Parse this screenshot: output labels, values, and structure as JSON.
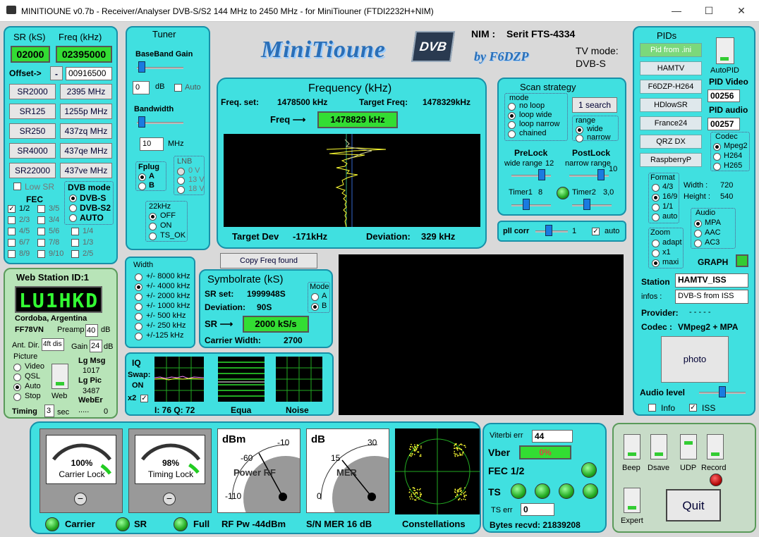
{
  "window": {
    "title": "MINITIOUNE v0.7b - Receiver/Analyser DVB-S/S2 144 MHz to 2450 MHz - for MiniTiouner (FTDI2232H+NIM)",
    "min": "—",
    "max": "☐",
    "close": "✕"
  },
  "sr_panel": {
    "sr_header": "SR (kS)",
    "freq_header": "Freq (kHz)",
    "sr_value": "02000",
    "freq_value": "02395000",
    "offset_label": "Offset->",
    "offset_sign": "-",
    "offset_value": "00916500",
    "sr_buttons": [
      "SR2000",
      "SR125",
      "SR250",
      "SR4000",
      "SR22000"
    ],
    "freq_buttons": [
      "2395 MHz",
      "1255p MHz",
      "437zq MHz",
      "437qe MHz",
      "437ve MHz"
    ],
    "low_sr": "Low SR",
    "fec_label": "FEC",
    "fec_items": [
      "1/2",
      "3/5",
      "2/3",
      "3/4",
      "4/5",
      "5/6",
      "6/7",
      "7/8",
      "8/9",
      "9/10"
    ],
    "dvb_mode_label": "DVB mode",
    "dvb_modes": [
      "DVB-S",
      "DVB-S2",
      "AUTO"
    ],
    "extra_fec": [
      "1/4",
      "1/3",
      "2/5"
    ]
  },
  "tuner": {
    "title": "Tuner",
    "bb_gain": "BaseBand Gain",
    "gain_value": "0",
    "db": "dB",
    "auto": "Auto",
    "bandwidth": "Bandwidth",
    "bw_value": "10",
    "mhz": "MHz",
    "fplug": "Fplug",
    "fplug_a": "A",
    "fplug_b": "B",
    "lnb": "LNB",
    "lnb_opts": [
      "0 V",
      "13 V",
      "18 V"
    ],
    "khz22": "22kHz",
    "khz22_opts": [
      "OFF",
      "ON",
      "TS_OK"
    ]
  },
  "header": {
    "logo": "MiniTioune",
    "logo_dvb": "DVB",
    "logo_by": "by F6DZP",
    "nim_label": "NIM :",
    "nim_value": "Serit FTS-4334",
    "tv_mode_label": "TV mode:",
    "tv_mode_value": "DVB-S"
  },
  "frequency": {
    "title": "Frequency (kHz)",
    "freq_set_label": "Freq. set:",
    "freq_set": "1478500 kHz",
    "target_label": "Target Freq:",
    "target": "1478329kHz",
    "freq_label": "Freq ⟶",
    "freq_value": "1478829 kHz",
    "target_dev_label": "Target Dev",
    "target_dev": "-171kHz",
    "deviation_label": "Deviation:",
    "deviation": "329 kHz"
  },
  "copy_freq": "Copy Freq found",
  "scan": {
    "title": "Scan strategy",
    "mode": "mode",
    "modes": [
      "no loop",
      "loop wide",
      "loop narrow",
      "chained"
    ],
    "search": "1 search",
    "range": "range",
    "ranges": [
      "wide",
      "narrow"
    ],
    "prelock": "PreLock",
    "prelock_sub": "wide range",
    "prelock_val": "12",
    "postlock": "PostLock",
    "postlock_sub": "narrow range",
    "postlock_val": "10",
    "timer1": "Timer1",
    "timer1_val": "8",
    "timer2": "Timer2",
    "timer2_val": "3,0",
    "pll": "pll corr",
    "pll_val": "1",
    "auto": "auto"
  },
  "width": {
    "title": "Width",
    "opts": [
      "+/- 8000 kHz",
      "+/- 4000 kHz",
      "+/- 2000 kHz",
      "+/- 1000 kHz",
      "+/- 500 kHz",
      "+/- 250 kHz",
      "+/-125 kHz"
    ]
  },
  "symbolrate": {
    "title": "Symbolrate (kS)",
    "sr_set_label": "SR set:",
    "sr_set": "1999948S",
    "dev_label": "Deviation:",
    "dev": "90S",
    "sr_label": "SR ⟶",
    "sr_value": "2000 kS/s",
    "carrier_label": "Carrier Width:",
    "carrier": "2700",
    "mode": "Mode",
    "mode_a": "A",
    "mode_b": "B"
  },
  "iq": {
    "title": "IQ",
    "swap": "Swap:",
    "swap_val": "ON",
    "x2": "x2",
    "iq_vals": "I: 76 Q: 72",
    "equa": "Equa",
    "noise": "Noise"
  },
  "web": {
    "title": "Web Station ID:1",
    "callsign": "LU1HKD",
    "city": "Cordoba, Argentina",
    "locator": "FF78VN",
    "preamp": "Preamp",
    "preamp_val": "40",
    "db": "dB",
    "ant_dir": "Ant. Dir.",
    "ant_val": "4ft dis",
    "gain": "Gain",
    "gain_val": "24",
    "picture": "Picture",
    "pics": [
      "Video",
      "QSL",
      "Auto",
      "Stop"
    ],
    "lg_msg": "Lg Msg",
    "lg_msg_val": "1017",
    "lg_pic": "Lg Pic",
    "lg_pic_val": "3487",
    "web": "Web",
    "weber": "WebEr",
    "weber_val": "0",
    "timing": "Timing",
    "timing_val": "3",
    "sec": "sec",
    "dots": "....."
  },
  "pids": {
    "title": "PIDs",
    "buttons": [
      "Pid from .ini",
      "HAMTV",
      "F6DZP-H264",
      "HDlowSR",
      "France24",
      "QRZ DX",
      "RaspberryP"
    ],
    "autopid": "AutoPID",
    "pid_video": "PID Video",
    "pid_video_val": "00256",
    "pid_audio": "PID audio",
    "pid_audio_val": "00257",
    "codec": "Codec",
    "codecs": [
      "Mpeg2",
      "H264",
      "H265"
    ],
    "format": "Format",
    "formats": [
      "4/3",
      "16/9",
      "1/1",
      "auto"
    ],
    "width_label": "Width :",
    "width_val": "720",
    "height_label": "Height :",
    "height_val": "540",
    "audio": "Audio",
    "audios": [
      "MPA",
      "AAC",
      "AC3"
    ],
    "zoom": "Zoom",
    "zooms": [
      "adapt",
      "x1",
      "maxi"
    ],
    "graph": "GRAPH",
    "station_label": "Station",
    "station_val": "HAMTV_ISS",
    "infos_label": "infos :",
    "infos_val": "DVB-S from ISS",
    "provider_label": "Provider:",
    "provider_val": "- - - - -",
    "codec_label": "Codec :",
    "codec_val": "VMpeg2 + MPA",
    "photo": "photo",
    "audio_level": "Audio level",
    "info": "Info",
    "iss": "ISS"
  },
  "bottom": {
    "carrier_lock_pct": "100%",
    "carrier_lock": "Carrier Lock",
    "timing_lock_pct": "98%",
    "timing_lock": "Timing Lock",
    "dbm": "dBm",
    "power_rf": "Power RF",
    "rf_m60": "-60",
    "rf_m10": "-10",
    "rf_m110": "-110",
    "db": "dB",
    "mer": "MER",
    "mer_15": "15",
    "mer_30": "30",
    "mer_0": "0",
    "carrier": "Carrier",
    "sr": "SR",
    "full": "Full",
    "rf_pw": "RF Pw -44dBm",
    "sn_mer": "S/N MER  16 dB",
    "constellations": "Constellations",
    "viterbi": "Viterbi err",
    "viterbi_val": "44",
    "vber": "Vber",
    "vber_val": "0%",
    "fec": "FEC 1/2",
    "ts": "TS",
    "ts_err": "TS err",
    "ts_err_val": "0",
    "bytes": "Bytes recvd:  21839208",
    "carrier_lock_frac": 1.0,
    "timing_lock_frac": 0.98
  },
  "controls": {
    "beep": "Beep",
    "dsave": "Dsave",
    "udp": "UDP",
    "record": "Record",
    "expert": "Expert",
    "quit": "Quit"
  },
  "colors": {
    "panel": "#40e0e0",
    "green_panel": "#b8e4b8",
    "lcd_green": "#33dd33"
  }
}
